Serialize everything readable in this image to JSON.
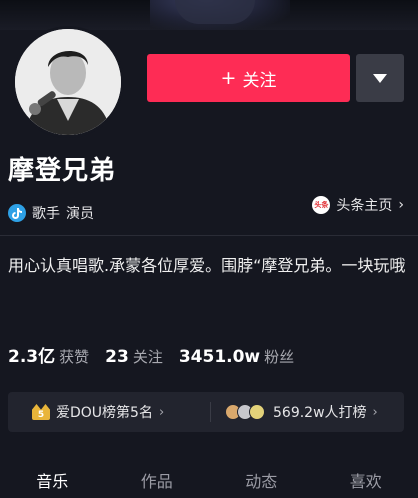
{
  "profile": {
    "name": "摩登兄弟",
    "tags": [
      "歌手",
      "演员"
    ],
    "toutiao_link": "头条主页",
    "toutiao_badge": "头条",
    "bio": "用心认真唱歌.承蒙各位厚爱。围脖“摩登兄弟。一块玩哦"
  },
  "actions": {
    "follow_label": "关注",
    "follow_icon": "plus-icon",
    "more_icon": "triangle-down-icon"
  },
  "stats": [
    {
      "value": "2.3亿",
      "label": "获赞"
    },
    {
      "value": "23",
      "label": "关注"
    },
    {
      "value": "3451.0w",
      "label": "粉丝"
    }
  ],
  "rank": {
    "badge_number": "5",
    "left_text": "爱DOU榜第5名",
    "right_text": "569.2w人打榜"
  },
  "tabs": [
    "音乐",
    "作品",
    "动态",
    "喜欢"
  ],
  "colors": {
    "background": "#151720",
    "accent": "#fe2c55",
    "rank_badge": "#e9b53a"
  }
}
